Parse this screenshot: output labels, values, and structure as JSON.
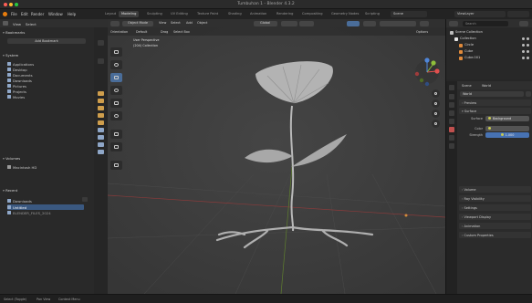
{
  "window": {
    "title": "Tumbuhan 1 - Blender 4.3.2"
  },
  "menu": [
    "File",
    "Edit",
    "Render",
    "Window",
    "Help"
  ],
  "workspaces": [
    "Layout",
    "Modeling",
    "Sculpting",
    "UV Editing",
    "Texture Paint",
    "Shading",
    "Animation",
    "Rendering",
    "Compositing",
    "Geometry Nodes",
    "Scripting"
  ],
  "active_workspace": "Modeling",
  "topright": {
    "scene": "Scene",
    "view_layer": "ViewLayer"
  },
  "file_browser": {
    "header": [
      "View",
      "Select"
    ],
    "bookmarks_title": "Bookmarks",
    "add_bookmark": "Add Bookmark",
    "system_title": "System",
    "system_items": [
      "Applications",
      "Desktop",
      "Documents",
      "Downloads",
      "Pictures",
      "Projects",
      "Movies"
    ],
    "volumes_title": "Volumes",
    "volumes_items": [
      "Macintosh HD"
    ],
    "recent_title": "Recent",
    "recent_items": [
      "Downloads",
      "Untitled",
      "BLENDER_FILES_2024"
    ]
  },
  "viewport": {
    "mode": "Object Mode",
    "menus": [
      "View",
      "Select",
      "Add",
      "Object"
    ],
    "orientation": "Global",
    "subheader": [
      "Orientation",
      "Default",
      "Drag",
      "Select Box"
    ],
    "options": "Options",
    "info_line1": "User Perspective",
    "info_line2": "(204) Collection"
  },
  "outliner": {
    "search_placeholder": "Search",
    "rows": [
      {
        "label": "Scene Collection",
        "icon_color": "#bdbdbd"
      },
      {
        "label": "Collection",
        "icon_color": "#e6e6e6"
      },
      {
        "label": "Circle",
        "icon_color": "#e08a3b"
      },
      {
        "label": "Cube",
        "icon_color": "#e08a3b"
      },
      {
        "label": "Cube.001",
        "icon_color": "#e08a3b"
      }
    ]
  },
  "properties": {
    "crumb_scene": "Scene",
    "crumb_world": "World",
    "world_name": "World",
    "sections": [
      "Preview",
      "Surface",
      "Volume",
      "Ray Visibility",
      "Settings",
      "Viewport Display",
      "Animation",
      "Custom Properties"
    ],
    "surface_label": "Surface",
    "surface_value": "Background",
    "color_label": "Color",
    "strength_label": "Strength",
    "strength_value": "1.000"
  },
  "statusbar": [
    "Select (Toggle)",
    "Pan View",
    "Context Menu"
  ]
}
